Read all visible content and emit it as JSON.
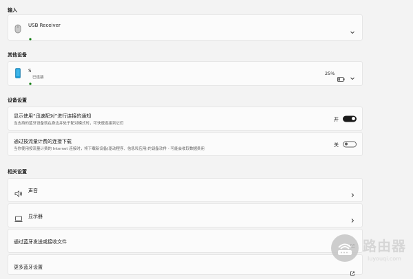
{
  "sections": {
    "input": "输入",
    "other_devices": "其他设备",
    "device_settings": "设备设置",
    "related_settings": "相关设置"
  },
  "input_device": {
    "name": "USB Receiver",
    "icon": "mouse-icon",
    "status_color": "#0f7b0f"
  },
  "other_device": {
    "name": "S",
    "status": "已连接",
    "battery": "25%",
    "icon": "phone-icon",
    "status_color": "#0f7b0f"
  },
  "swift_pair": {
    "title": "显示使用“迅速配对”进行连接的通知",
    "subtitle": "当支持的蓝牙设备就在身边并处于配对模式时，可快速连接到它们",
    "state_label": "开",
    "on": true
  },
  "metered": {
    "title": "通过按流量计费的连接下载",
    "subtitle": "当你使用按流量计费的 Internet 连接时，将下载新设备(驱动程序、信息和应用)的设备软件 - 可能会收取数据费用",
    "state_label": "关",
    "on": false
  },
  "related": {
    "sound": "声音",
    "display": "显示器",
    "send_receive": "通过蓝牙发送或接收文件",
    "more_bluetooth": "更多蓝牙设置"
  },
  "watermark": {
    "cn": "路由器",
    "en": "luyouqi.com"
  },
  "colors": {
    "accent": "#1b1b1b",
    "phone_icon": "#1a9ad6"
  }
}
